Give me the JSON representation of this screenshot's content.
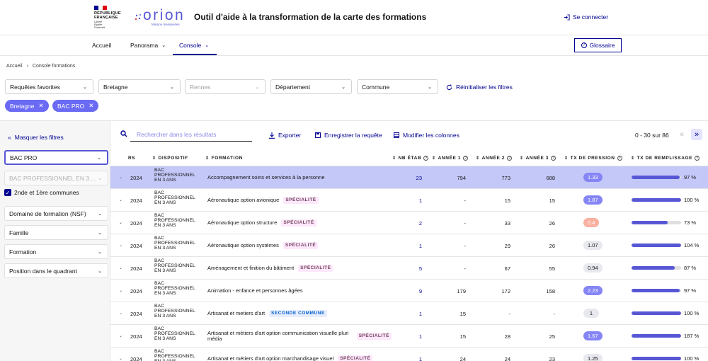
{
  "header": {
    "republic_lines": [
      "RÉPUBLIQUE",
      "FRANÇAISE"
    ],
    "republic_motto": [
      "Liberté",
      "Égalité",
      "Fraternité"
    ],
    "logo_text": "orion",
    "logo_subtitle": "Mission Inserjeunes",
    "title": "Outil d'aide à la transformation de la carte des formations",
    "login_label": "Se connecter"
  },
  "nav": {
    "items": [
      {
        "label": "Accueil",
        "dropdown": false
      },
      {
        "label": "Panorama",
        "dropdown": true
      },
      {
        "label": "Console",
        "dropdown": true,
        "active": true
      }
    ],
    "glossaire_label": "Glossaire"
  },
  "breadcrumb": [
    "Accueil",
    "Console formations"
  ],
  "filters": {
    "selects": [
      {
        "label": "Requêtes favorites",
        "disabled": false
      },
      {
        "label": "Bretagne",
        "disabled": false
      },
      {
        "label": "Rennes",
        "disabled": true
      },
      {
        "label": "Département",
        "disabled": false
      },
      {
        "label": "Commune",
        "disabled": false
      }
    ],
    "reset_label": "Réinitialiser les filtres",
    "tags": [
      "Bretagne",
      "BAC PRO"
    ]
  },
  "sidebar": {
    "hide_label": "Masquer les filtres",
    "selects": [
      {
        "label": "BAC PRO",
        "focused": true
      },
      {
        "label": "BAC PROFESSIONNEL EN 3 ...",
        "disabled": true
      }
    ],
    "checkbox_label": "2nde et 1ère communes",
    "more_selects": [
      "Domaine de formation (NSF)",
      "Famille",
      "Formation",
      "Position dans le quadrant"
    ]
  },
  "toolbar": {
    "search_placeholder": "Rechercher dans les résultats",
    "export_label": "Exporter",
    "save_label": "Enregistrer la requête",
    "columns_label": "Modifier les colonnes",
    "pagination": "0 - 30 sur 86"
  },
  "table": {
    "columns": [
      "RS",
      "DISPOSITIF",
      "FORMATION",
      "NB ÉTAB",
      "ANNÉE 1",
      "ANNÉE 2",
      "ANNÉE 3",
      "TX DE PRESSION",
      "TX DE REMPLISSAGE"
    ],
    "rows": [
      {
        "rs": "2024",
        "dispositif": "BAC PROFESSIONNEL EN 3 ANS",
        "formation": "Accompagnement soins et services à la personne",
        "badge": "",
        "nb": "23",
        "a1": "794",
        "a2": "773",
        "a3": "688",
        "tx": "1.33",
        "tx_level": "high",
        "remplissage": 97,
        "remplissage_label": "97 %",
        "selected": true
      },
      {
        "rs": "2024",
        "dispositif": "BAC PROFESSIONNEL EN 3 ANS",
        "formation": "Aéronautique option avionique",
        "badge": "SPÉCIALITÉ",
        "nb": "1",
        "a1": "-",
        "a2": "15",
        "a3": "15",
        "tx": "1.87",
        "tx_level": "high",
        "remplissage": 100,
        "remplissage_label": "100 %"
      },
      {
        "rs": "2024",
        "dispositif": "BAC PROFESSIONNEL EN 3 ANS",
        "formation": "Aéronautique option structure",
        "badge": "SPÉCIALITÉ",
        "nb": "2",
        "a1": "-",
        "a2": "33",
        "a3": "26",
        "tx": "0.4",
        "tx_level": "low",
        "remplissage": 73,
        "remplissage_label": "73 %"
      },
      {
        "rs": "2024",
        "dispositif": "BAC PROFESSIONNEL EN 3 ANS",
        "formation": "Aéronautique option systèmes",
        "badge": "SPÉCIALITÉ",
        "nb": "1",
        "a1": "-",
        "a2": "29",
        "a3": "26",
        "tx": "1.07",
        "tx_level": "mid",
        "remplissage": 100,
        "remplissage_label": "104 %"
      },
      {
        "rs": "2024",
        "dispositif": "BAC PROFESSIONNEL EN 3 ANS",
        "formation": "Aménagement et finition du bâtiment",
        "badge": "SPÉCIALITÉ",
        "nb": "5",
        "a1": "-",
        "a2": "67",
        "a3": "55",
        "tx": "0.94",
        "tx_level": "mid",
        "remplissage": 87,
        "remplissage_label": "87 %"
      },
      {
        "rs": "2024",
        "dispositif": "BAC PROFESSIONNEL EN 3 ANS",
        "formation": "Animation - enfance et personnes âgées",
        "badge": "",
        "nb": "9",
        "a1": "179",
        "a2": "172",
        "a3": "158",
        "tx": "2.23",
        "tx_level": "high",
        "remplissage": 97,
        "remplissage_label": "97 %"
      },
      {
        "rs": "2024",
        "dispositif": "BAC PROFESSIONNEL EN 3 ANS",
        "formation": "Artisanat et metiers d'art",
        "badge": "SECONDE COMMUNE",
        "badge_type": "sec",
        "nb": "1",
        "a1": "15",
        "a2": "-",
        "a3": "-",
        "tx": "1",
        "tx_level": "mid",
        "remplissage": 100,
        "remplissage_label": "100 %"
      },
      {
        "rs": "2024",
        "dispositif": "BAC PROFESSIONNEL EN 3 ANS",
        "formation": "Artisanat et métiers d'art option communication visuelle pluri média",
        "badge": "SPÉCIALITÉ",
        "nb": "1",
        "a1": "15",
        "a2": "28",
        "a3": "25",
        "tx": "1.67",
        "tx_level": "high",
        "remplissage": 100,
        "remplissage_label": "187 %"
      },
      {
        "rs": "2024",
        "dispositif": "BAC PROFESSIONNEL EN 3 ANS",
        "formation": "Artisanat et métiers d'art option marchandisage visuel",
        "badge": "SPÉCIALITÉ",
        "nb": "1",
        "a1": "24",
        "a2": "24",
        "a3": "23",
        "tx": "1.25",
        "tx_level": "mid",
        "remplissage": 100,
        "remplissage_label": "100 %"
      }
    ]
  },
  "colors": {
    "primary": "#000091",
    "accent": "#6a6af4",
    "bar": "#5757d6",
    "selected_row": "#c4c8f8"
  }
}
